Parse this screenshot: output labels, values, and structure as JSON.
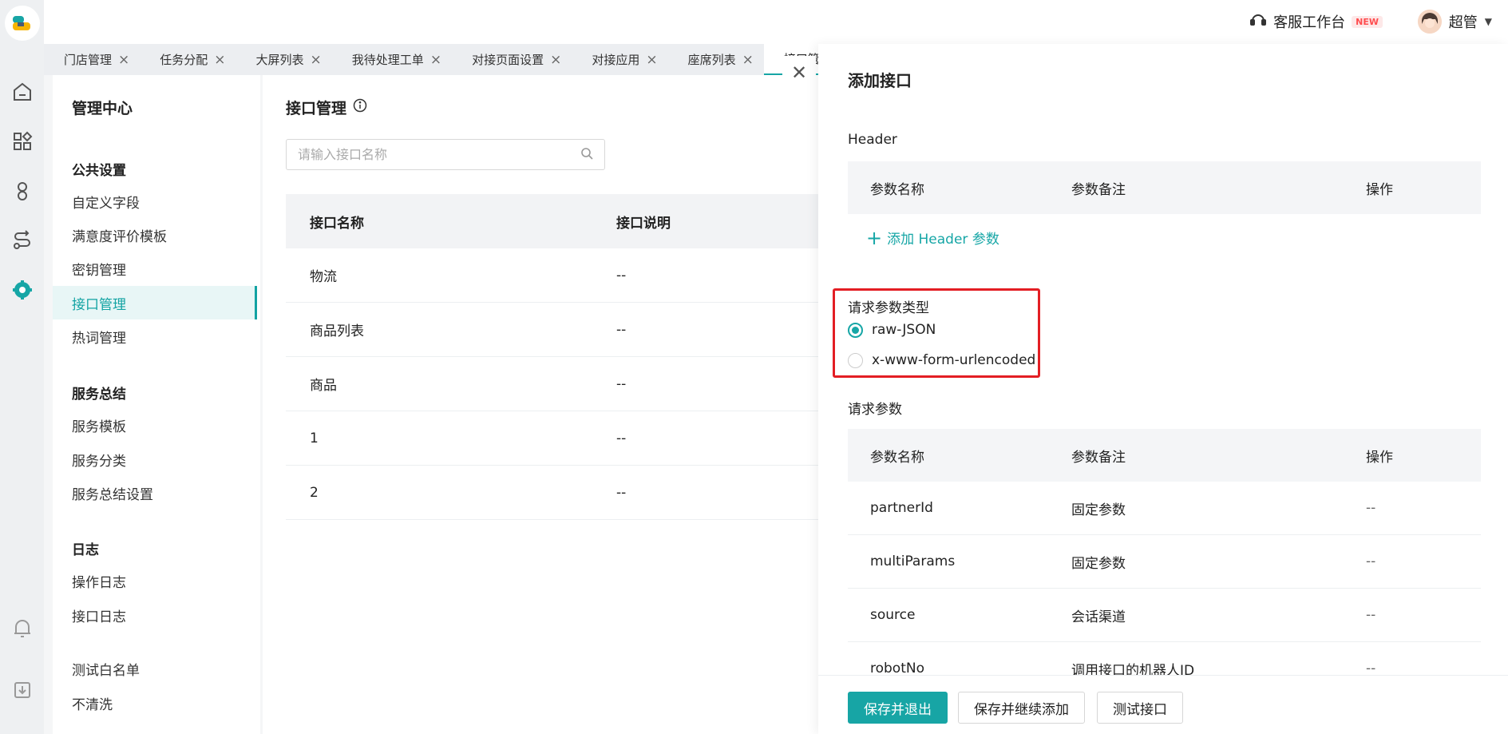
{
  "colors": {
    "accent": "#16a6a6",
    "highlight": "#e31e24",
    "new_badge": "#ff4d4f"
  },
  "header": {
    "workbench_label": "客服工作台",
    "new_badge": "NEW",
    "user_name": "超管"
  },
  "tabs": [
    {
      "label": "门店管理"
    },
    {
      "label": "任务分配"
    },
    {
      "label": "大屏列表"
    },
    {
      "label": "我待处理工单"
    },
    {
      "label": "对接页面设置"
    },
    {
      "label": "对接应用"
    },
    {
      "label": "座席列表"
    },
    {
      "label": "接口管理",
      "active": true
    }
  ],
  "subnav": {
    "title": "管理中心",
    "groups": [
      {
        "title": "公共设置",
        "items": [
          "自定义字段",
          "满意度评价模板",
          "密钥管理",
          "接口管理",
          "热词管理"
        ]
      },
      {
        "title": "服务总结",
        "items": [
          "服务模板",
          "服务分类",
          "服务总结设置"
        ]
      },
      {
        "title": "日志",
        "items": [
          "操作日志",
          "接口日志"
        ]
      },
      {
        "title": "",
        "items": [
          "测试白名单",
          "不清洗"
        ]
      }
    ]
  },
  "main": {
    "title": "接口管理",
    "search_placeholder": "请输入接口名称",
    "columns": [
      "接口名称",
      "接口说明"
    ],
    "rows": [
      [
        "物流",
        "--"
      ],
      [
        "商品列表",
        "--"
      ],
      [
        "商品",
        "--"
      ],
      [
        "1",
        "--"
      ],
      [
        "2",
        "--"
      ]
    ]
  },
  "drawer": {
    "title": "添加接口",
    "header_section": "Header",
    "param_columns": [
      "参数名称",
      "参数备注",
      "操作"
    ],
    "add_header_label": "添加 Header 参数",
    "param_type_label": "请求参数类型",
    "param_types": [
      "raw-JSON",
      "x-www-form-urlencoded"
    ],
    "param_type_selected": "raw-JSON",
    "request_params_label": "请求参数",
    "request_params": [
      [
        "partnerId",
        "固定参数",
        "--"
      ],
      [
        "multiParams",
        "固定参数",
        "--"
      ],
      [
        "source",
        "会话渠道",
        "--"
      ],
      [
        "robotNo",
        "调用接口的机器人ID",
        "--"
      ]
    ],
    "buttons": {
      "save_exit": "保存并退出",
      "save_continue": "保存并继续添加",
      "test": "测试接口"
    }
  }
}
